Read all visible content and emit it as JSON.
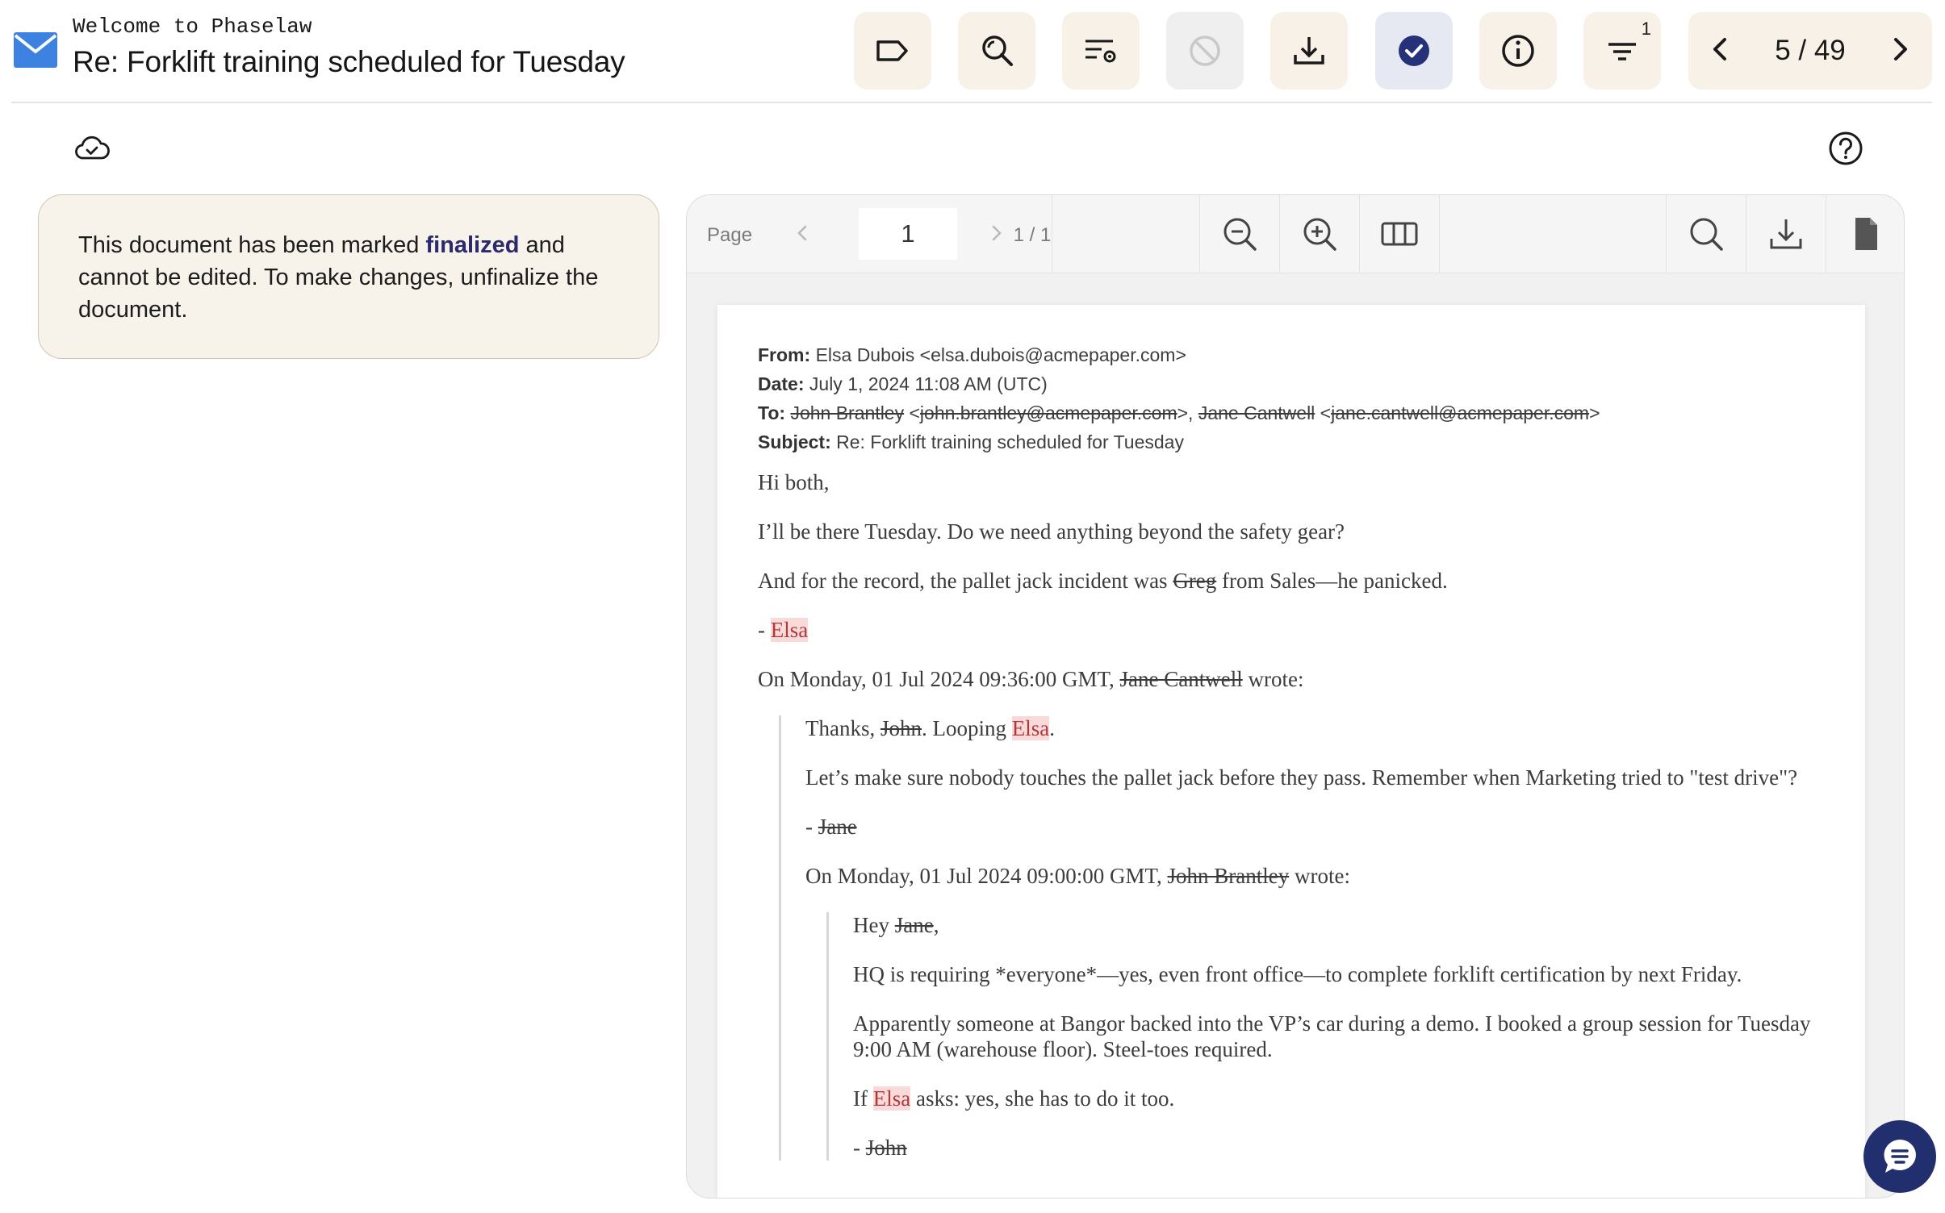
{
  "header": {
    "welcome": "Welcome to Phaselaw",
    "title": "Re: Forklift training scheduled for Tuesday",
    "filter_badge": "1",
    "pager": "5 / 49"
  },
  "notice": {
    "before": "This document has been marked ",
    "bold": "finalized",
    "after": " and cannot be edited. To make changes, unfinalize the document."
  },
  "viewer": {
    "page_label": "Page",
    "page_value": "1",
    "page_total": "1 / 1"
  },
  "email": {
    "from_label": "From:",
    "from_value": "Elsa Dubois <elsa.dubois@acmepaper.com>",
    "date_label": "Date:",
    "date_value": "July 1, 2024 11:08 AM (UTC)",
    "to_label": "To:",
    "to_name1": "John Brantley",
    "to_email1": "john.brantley@acmepaper.com",
    "to_sep": ">, ",
    "to_name2": "Jane Cantwell",
    "to_email2": "jane.cantwell@acmepaper.com",
    "subject_label": "Subject:",
    "subject_value": "Re: Forklift training scheduled for Tuesday",
    "p1": "Hi both,",
    "p2": "I’ll be there Tuesday. Do we need anything beyond the safety gear?",
    "p3_a": "And for the record, the pallet jack incident was ",
    "p3_red": "Greg",
    "p3_b": " from Sales—he panicked.",
    "sig1_dash": "- ",
    "sig1_name": "Elsa",
    "wrote1_a": "On Monday, 01 Jul 2024 09:36:00 GMT, ",
    "wrote1_name": "Jane Cantwell",
    "wrote1_b": " wrote:",
    "q1_a": "Thanks, ",
    "q1_red": "John",
    "q1_b": ". Looping ",
    "q1_hl": "Elsa",
    "q1_c": ".",
    "q2": "Let’s make sure nobody touches the pallet jack before they pass. Remember when Marketing tried to \"test drive\"?",
    "sig2_dash": "- ",
    "sig2_name": "Jane",
    "wrote2_a": "On Monday, 01 Jul 2024 09:00:00 GMT, ",
    "wrote2_name": "John Brantley",
    "wrote2_b": " wrote:",
    "r1_a": "Hey ",
    "r1_red": "Jane",
    "r1_b": ",",
    "r2": "HQ is requiring *everyone*—yes, even front office—to complete forklift certification by next Friday.",
    "r3": "Apparently someone at Bangor backed into the VP’s car during a demo. I booked a group session for Tuesday 9:00 AM (warehouse floor). Steel-toes required.",
    "r4_a": "If ",
    "r4_hl": "Elsa",
    "r4_b": " asks: yes, she has to do it too.",
    "sig3_dash": "- ",
    "sig3_name": "John"
  }
}
